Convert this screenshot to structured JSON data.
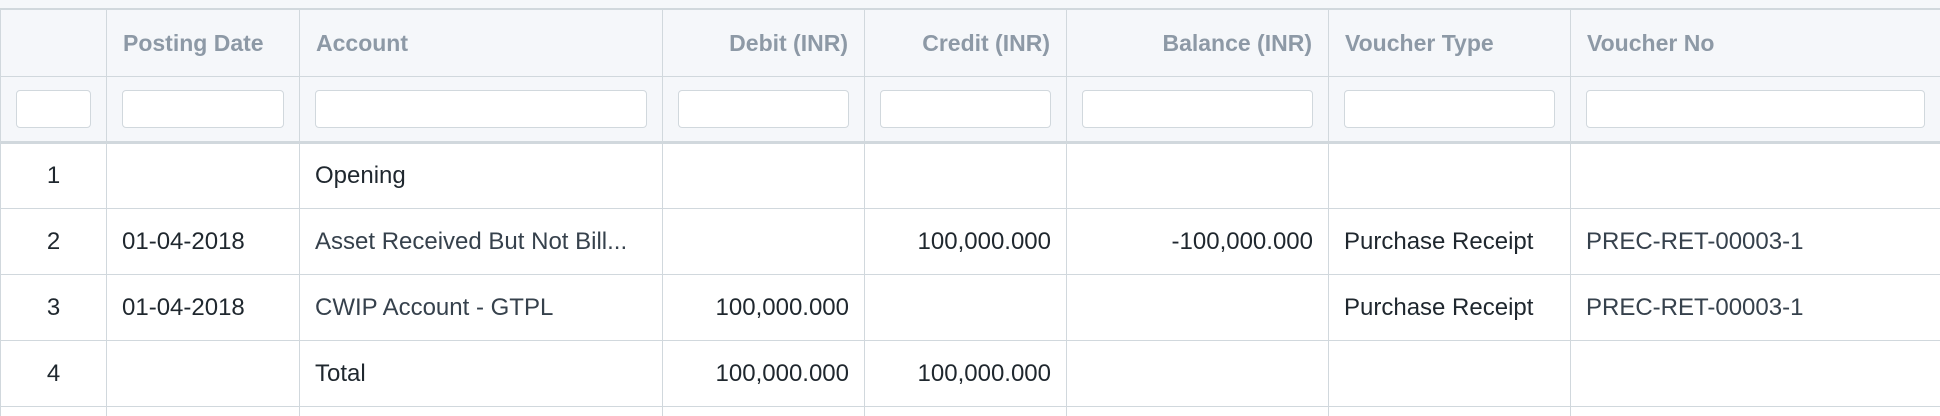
{
  "columns": {
    "row_number": "",
    "posting_date": "Posting Date",
    "account": "Account",
    "debit": "Debit (INR)",
    "credit": "Credit (INR)",
    "balance": "Balance (INR)",
    "voucher_type": "Voucher Type",
    "voucher_no": "Voucher No"
  },
  "rows": [
    {
      "row_number": "1",
      "posting_date": "",
      "account": "Opening",
      "debit": "",
      "credit": "",
      "balance": "",
      "voucher_type": "",
      "voucher_no": ""
    },
    {
      "row_number": "2",
      "posting_date": "01-04-2018",
      "account": "Asset Received But Not Bill...",
      "debit": "",
      "credit": "100,000.000",
      "balance": "-100,000.000",
      "voucher_type": "Purchase Receipt",
      "voucher_no": "PREC-RET-00003-1"
    },
    {
      "row_number": "3",
      "posting_date": "01-04-2018",
      "account": "CWIP Account - GTPL",
      "debit": "100,000.000",
      "credit": "",
      "balance": "",
      "voucher_type": "Purchase Receipt",
      "voucher_no": "PREC-RET-00003-1"
    },
    {
      "row_number": "4",
      "posting_date": "",
      "account": "Total",
      "debit": "100,000.000",
      "credit": "100,000.000",
      "balance": "",
      "voucher_type": "",
      "voucher_no": ""
    }
  ],
  "colors": {
    "header_bg": "#f5f7fa",
    "header_text": "#8d99a6",
    "border": "#d1d8dd",
    "text": "#1f272e",
    "link_text": "#36414c"
  }
}
